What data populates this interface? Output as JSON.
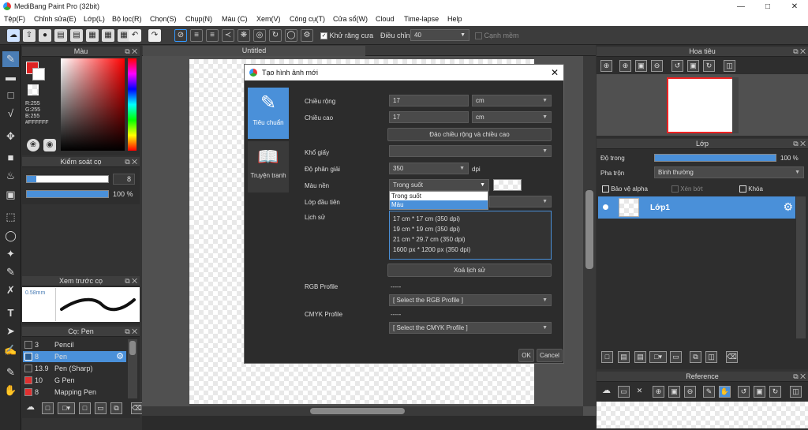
{
  "app": {
    "title": "MediBang Paint Pro (32bit)",
    "min_icon": "minimize-icon",
    "max_icon": "maximize-icon",
    "close_icon": "close-icon"
  },
  "menu": [
    "Tệp(F)",
    "Chỉnh sửa(E)",
    "Lớp(L)",
    "Bộ lọc(R)",
    "Chọn(S)",
    "Chụp(N)",
    "Màu (C)",
    "Xem(V)",
    "Công cụ(T)",
    "Cửa sổ(W)",
    "Cloud",
    "Time-lapse",
    "Help"
  ],
  "toolbar": {
    "antialias_label": "Khử răng cưa",
    "adjust_label": "Điều chỉnh",
    "adjust_value": "40",
    "edge_label": "Cạnh mềm"
  },
  "color_panel": {
    "title": "Màu",
    "r": "R:255",
    "g": "G:255",
    "b": "B:255",
    "hex": "#FFFFFF"
  },
  "brush_control": {
    "title": "Kiểm soát cọ",
    "size": "8",
    "opacity": "100 %"
  },
  "brush_preview": {
    "title": "Xem trước cọ",
    "size_label": "0.58mm"
  },
  "brush_list": {
    "title": "Cọ: Pen",
    "items": [
      {
        "size": "3",
        "name": "Pencil",
        "color": "#333333"
      },
      {
        "size": "8",
        "name": "Pen",
        "color": "#2a5b8f"
      },
      {
        "size": "13.9",
        "name": "Pen (Sharp)",
        "color": "#333333"
      },
      {
        "size": "10",
        "name": "G Pen",
        "color": "#e03030"
      },
      {
        "size": "8",
        "name": "Mapping Pen",
        "color": "#e03030"
      }
    ]
  },
  "canvas_tab": "Untitled",
  "dialog": {
    "title": "Tạo hình ảnh mới",
    "tab_standard": "Tiêu chuẩn",
    "tab_comic": "Truyện tranh",
    "width_label": "Chiều rộng",
    "width_value": "17",
    "width_unit": "cm",
    "height_label": "Chiều cao",
    "height_value": "17",
    "height_unit": "cm",
    "swap_button": "Đảo chiều rộng và chiều cao",
    "paper_label": "Khổ giấy",
    "paper_value": "",
    "resolution_label": "Độ phân giải",
    "resolution_value": "350",
    "resolution_unit": "dpi",
    "bg_label": "Màu nền",
    "bg_value": "Trong suốt",
    "bg_options": [
      "Trong suốt",
      "Màu"
    ],
    "first_layer_label": "Lớp đầu tiên",
    "history_label": "Lịch sử",
    "history": [
      "17 cm * 17 cm (350 dpi)",
      "19 cm * 19 cm (350 dpi)",
      "21 cm * 29.7 cm (350 dpi)",
      "1600 px * 1200 px (350 dpi)"
    ],
    "clear_history": "Xoá lịch sử",
    "rgb_label": "RGB Profile",
    "rgb_dashes": "-----",
    "rgb_select": "[ Select the RGB Profile ]",
    "cmyk_label": "CMYK Profile",
    "cmyk_dashes": "-----",
    "cmyk_select": "[ Select the CMYK Profile ]",
    "ok": "OK",
    "cancel": "Cancel"
  },
  "navigator": {
    "title": "Hoa tiêu"
  },
  "layer_panel": {
    "title": "Lớp",
    "opacity_label": "Độ trong",
    "opacity_value": "100 %",
    "blend_label": "Pha trộn",
    "blend_value": "Bình thường",
    "protect_alpha": "Bảo vệ alpha",
    "clipping": "Xén bớt",
    "lock": "Khóa",
    "layer_name": "Lớp1"
  },
  "reference": {
    "title": "Reference"
  }
}
